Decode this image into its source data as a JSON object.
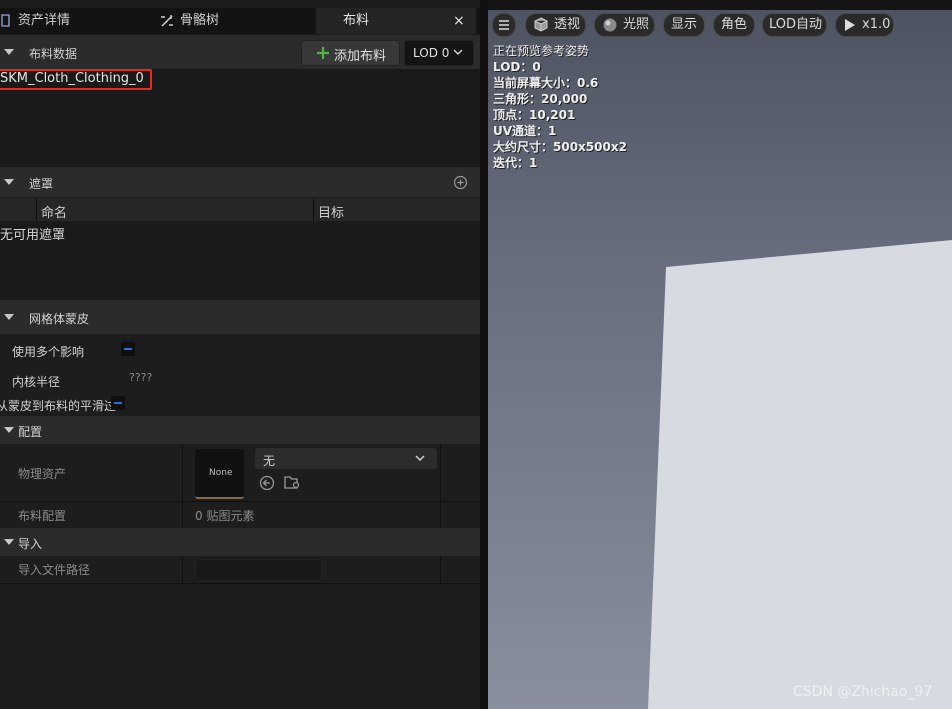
{
  "tabs": {
    "asset_details": "资产详情",
    "skeleton_tree": "骨骼树",
    "clothing": "布料",
    "close": "×"
  },
  "cloth_data": {
    "header": "布料数据",
    "add_button": "添加布料",
    "lod_select": "LOD 0",
    "item": "SKM_Cloth_Clothing_0"
  },
  "masks": {
    "header": "遮罩",
    "col_name": "命名",
    "col_target": "目标",
    "empty": "无可用遮罩"
  },
  "mesh_skinning": {
    "header": "网格体蒙皮",
    "use_multiple": "使用多个影响",
    "kernel_radius": "内核半径",
    "kernel_radius_value": "????",
    "smooth_transition": "从蒙皮到布料的平滑过"
  },
  "config": {
    "header": "配置",
    "physics_asset_label": "物理资产",
    "thumbnail_text": "None",
    "physics_asset_value": "无",
    "cloth_config_label": "布料配置",
    "cloth_config_value": "0 贴图元素"
  },
  "import": {
    "header": "导入",
    "file_path_label": "导入文件路径",
    "file_path_value": ""
  },
  "viewport": {
    "toolbar": {
      "perspective": "透视",
      "lighting": "光照",
      "show": "显示",
      "character": "角色",
      "lod_auto": "LOD自动",
      "speed": "x1.0"
    },
    "info": [
      "正在预览参考姿势",
      "LOD：0",
      "当前屏幕大小：0.6",
      "三角形：20,000",
      "顶点：10,201",
      "UV通道：1",
      "大约尺寸：500x500x2",
      "迭代：1"
    ],
    "watermark": "CSDN @Zhichao_97"
  },
  "colors": {
    "highlight_box": "#e8291c",
    "accent_blue": "#1f6fd6",
    "add_icon_green": "#53b548"
  }
}
